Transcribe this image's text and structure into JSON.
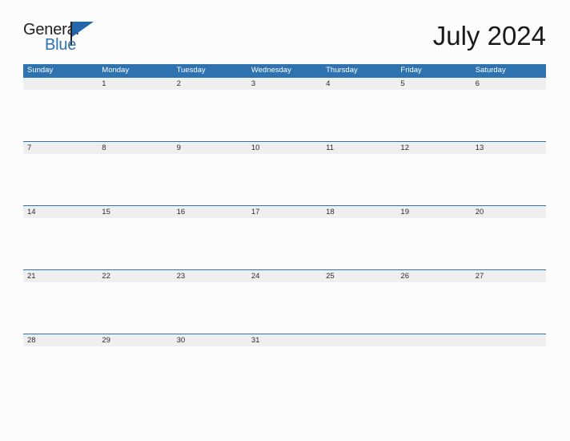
{
  "brand": {
    "name_part1": "General",
    "name_part2": "Blue",
    "accent_color": "#2e72b0",
    "text_color": "#231f20"
  },
  "header": {
    "title": "July 2024"
  },
  "calendar": {
    "month": "July",
    "year": "2024",
    "header_bg": "#2e72b0",
    "header_text_color": "#ffffff",
    "date_band_bg": "#efefef",
    "rule_color": "#2e72b0",
    "weekdays": [
      "Sunday",
      "Monday",
      "Tuesday",
      "Wednesday",
      "Thursday",
      "Friday",
      "Saturday"
    ],
    "weeks": [
      [
        "",
        "1",
        "2",
        "3",
        "4",
        "5",
        "6"
      ],
      [
        "7",
        "8",
        "9",
        "10",
        "11",
        "12",
        "13"
      ],
      [
        "14",
        "15",
        "16",
        "17",
        "18",
        "19",
        "20"
      ],
      [
        "21",
        "22",
        "23",
        "24",
        "25",
        "26",
        "27"
      ],
      [
        "28",
        "29",
        "30",
        "31",
        "",
        "",
        ""
      ]
    ]
  }
}
